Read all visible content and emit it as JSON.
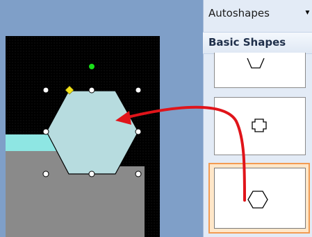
{
  "panel": {
    "title": "Autoshapes",
    "group_header": "Basic Shapes",
    "tiles": [
      "hexagon-partial",
      "cross-shape",
      "hexagon"
    ],
    "selected_tile": "hexagon"
  },
  "colors": {
    "accent_arrow": "#e0141a",
    "shape_fill": "#b7dcdf",
    "rotation_handle": "#19e019",
    "adjust_handle": "#f2e21a",
    "selected_tile_border": "#f29b52"
  }
}
